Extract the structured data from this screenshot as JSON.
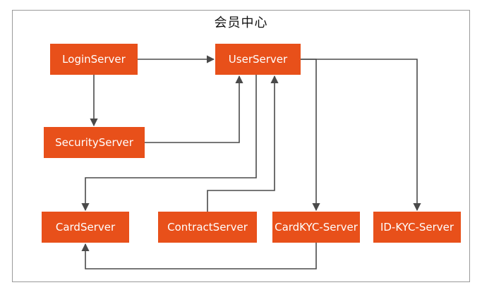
{
  "title": "会员中心",
  "colors": {
    "node_fill": "#E8501A",
    "node_text": "#FFFFFF",
    "edge": "#4A4A4A",
    "frame_border": "#9A9A9A"
  },
  "nodes": {
    "login": "LoginServer",
    "user": "UserServer",
    "security": "SecurityServer",
    "card": "CardServer",
    "contract": "ContractServer",
    "cardkyc": "CardKYC-Server",
    "idkyc": "ID-KYC-Server"
  },
  "edges": [
    {
      "from": "LoginServer",
      "to": "UserServer"
    },
    {
      "from": "LoginServer",
      "to": "SecurityServer"
    },
    {
      "from": "SecurityServer",
      "to": "UserServer"
    },
    {
      "from": "UserServer",
      "to": "CardServer"
    },
    {
      "from": "ContractServer",
      "to": "UserServer"
    },
    {
      "from": "UserServer",
      "to": "CardKYC-Server"
    },
    {
      "from": "UserServer",
      "to": "ID-KYC-Server"
    },
    {
      "from": "CardKYC-Server",
      "to": "CardServer"
    }
  ]
}
